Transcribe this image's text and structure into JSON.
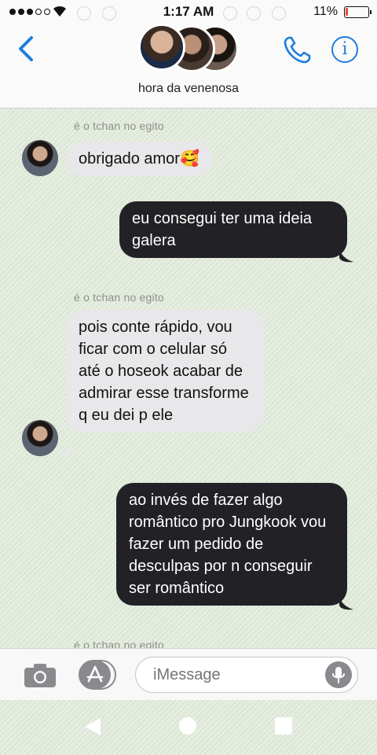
{
  "status_bar": {
    "time": "1:17 AM",
    "battery_percent": "11%",
    "battery_level": 0.11
  },
  "header": {
    "group_name": "hora da venenosa"
  },
  "messages": [
    {
      "sender": "é o tchan no egito",
      "text": "obrigado amor🥰",
      "direction": "incoming"
    },
    {
      "text": "eu consegui ter uma ideia galera",
      "direction": "outgoing"
    },
    {
      "sender": "é o tchan no egito",
      "text": "pois conte rápido, vou ficar com o celular só até o hoseok acabar de admirar esse transforme q eu dei p ele",
      "direction": "incoming"
    },
    {
      "text": "ao invés de fazer algo romântico pro Jungkook vou fazer um pedido de desculpas por n conseguir ser romântico",
      "direction": "outgoing"
    },
    {
      "sender": "é o tchan no egito",
      "direction": "incoming"
    }
  ],
  "compose": {
    "placeholder": "iMessage"
  },
  "colors": {
    "accent": "#1e7ddc",
    "incoming_bubble": "#e8e8ea",
    "outgoing_bubble": "#222226",
    "background": "#e2ebdc"
  },
  "icons": [
    "back-chevron-icon",
    "phone-icon",
    "info-icon",
    "camera-icon",
    "app-store-icon",
    "microphone-icon",
    "nav-back-icon",
    "nav-home-icon",
    "nav-recents-icon"
  ]
}
